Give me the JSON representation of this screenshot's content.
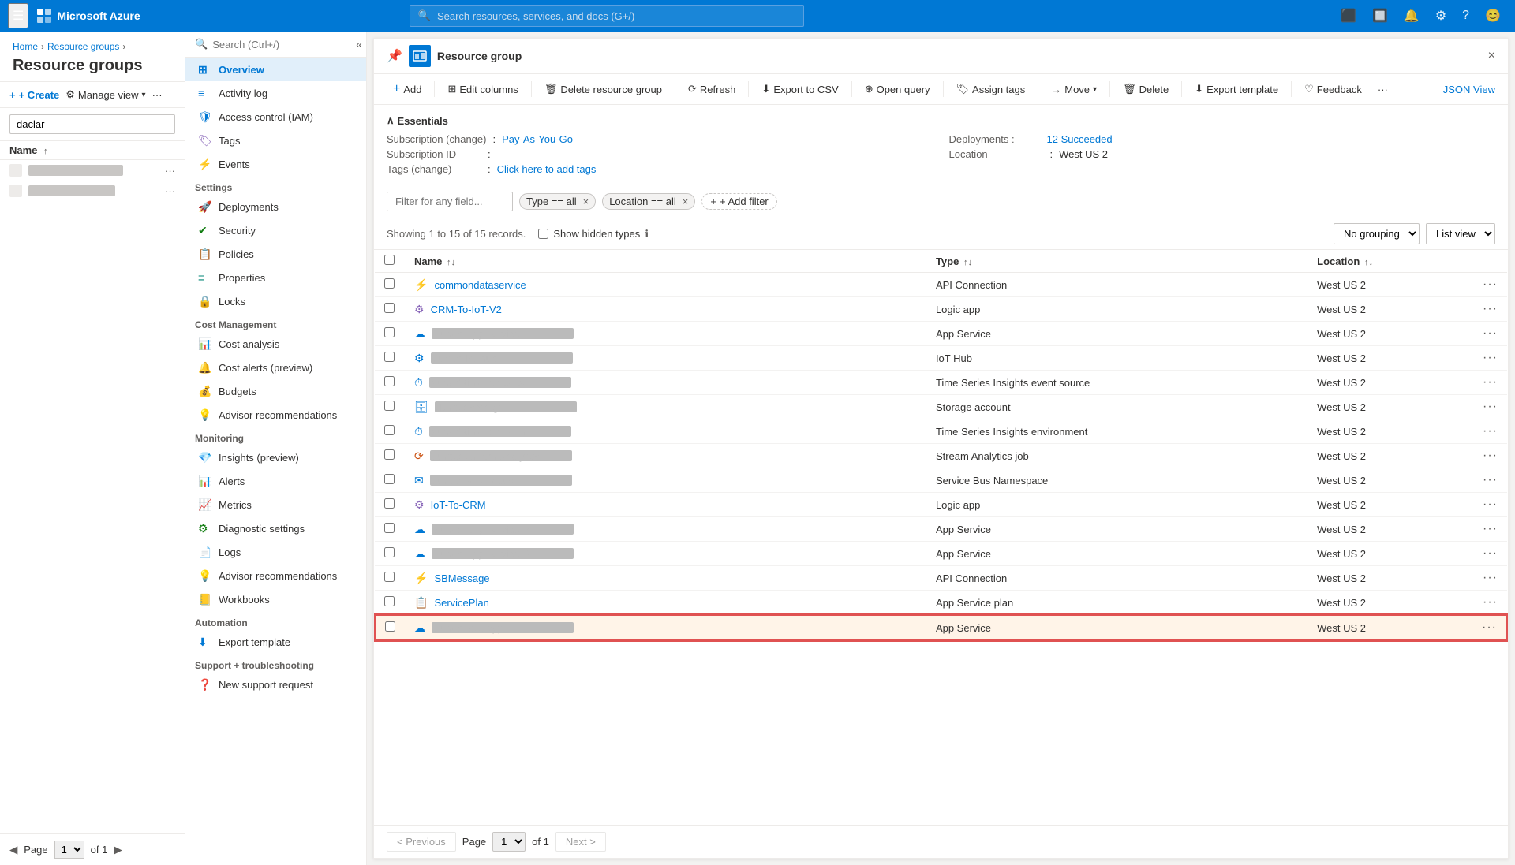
{
  "topNav": {
    "logo": "Microsoft Azure",
    "searchPlaceholder": "Search resources, services, and docs (G+/)",
    "hamburgerLabel": "Menu"
  },
  "breadcrumb": {
    "items": [
      "Home",
      "Resource groups"
    ]
  },
  "pageTitle": "Resource groups",
  "sidebarActions": {
    "create": "+ Create",
    "manageView": "Manage view",
    "more": "···"
  },
  "sidebarSearch": {
    "placeholder": "daclar",
    "searchPlaceholder": "Search (Ctrl+/)"
  },
  "sidebarColumns": {
    "nameHeader": "Name"
  },
  "sidebarItems": [
    {
      "name": "item1",
      "blurred": true
    },
    {
      "name": "item2",
      "blurred": true
    }
  ],
  "leftNavItems": [
    {
      "id": "overview",
      "label": "Overview",
      "icon": "grid"
    },
    {
      "id": "activity-log",
      "label": "Activity log",
      "icon": "list"
    },
    {
      "id": "access-control",
      "label": "Access control (IAM)",
      "icon": "shield"
    },
    {
      "id": "tags",
      "label": "Tags",
      "icon": "tag"
    },
    {
      "id": "events",
      "label": "Events",
      "icon": "lightning"
    }
  ],
  "settingsSection": "Settings",
  "settingsItems": [
    {
      "id": "deployments",
      "label": "Deployments",
      "icon": "rocket"
    },
    {
      "id": "security",
      "label": "Security",
      "icon": "shield-check"
    },
    {
      "id": "policies",
      "label": "Policies",
      "icon": "policy"
    },
    {
      "id": "properties",
      "label": "Properties",
      "icon": "properties"
    },
    {
      "id": "locks",
      "label": "Locks",
      "icon": "lock"
    }
  ],
  "costSection": "Cost Management",
  "costItems": [
    {
      "id": "cost-analysis",
      "label": "Cost analysis",
      "icon": "chart"
    },
    {
      "id": "cost-alerts",
      "label": "Cost alerts (preview)",
      "icon": "bell"
    },
    {
      "id": "budgets",
      "label": "Budgets",
      "icon": "budget"
    },
    {
      "id": "advisor-rec-cost",
      "label": "Advisor recommendations",
      "icon": "advisor"
    }
  ],
  "monitoringSection": "Monitoring",
  "monitoringItems": [
    {
      "id": "insights",
      "label": "Insights (preview)",
      "icon": "insights"
    },
    {
      "id": "alerts",
      "label": "Alerts",
      "icon": "alert"
    },
    {
      "id": "metrics",
      "label": "Metrics",
      "icon": "metrics"
    },
    {
      "id": "diagnostic",
      "label": "Diagnostic settings",
      "icon": "diagnostic"
    },
    {
      "id": "logs",
      "label": "Logs",
      "icon": "logs"
    },
    {
      "id": "advisor-rec",
      "label": "Advisor recommendations",
      "icon": "advisor2"
    },
    {
      "id": "workbooks",
      "label": "Workbooks",
      "icon": "workbooks"
    }
  ],
  "automationSection": "Automation",
  "automationItems": [
    {
      "id": "export-template",
      "label": "Export template",
      "icon": "export"
    }
  ],
  "supportSection": "Support + troubleshooting",
  "supportItems": [
    {
      "id": "new-support",
      "label": "New support request",
      "icon": "support"
    }
  ],
  "pagination": {
    "previous": "< Previous",
    "pageLabel": "Page",
    "pageValue": "1",
    "ofLabel": "of 1",
    "next": "Next >"
  },
  "panel": {
    "resourceGroupLabel": "Resource group",
    "closeLabel": "×"
  },
  "toolbar": {
    "add": "Add",
    "editColumns": "Edit columns",
    "deleteResourceGroup": "Delete resource group",
    "refresh": "Refresh",
    "exportToCSV": "Export to CSV",
    "openQuery": "Open query",
    "assignTags": "Assign tags",
    "move": "Move",
    "delete": "Delete",
    "exportTemplate": "Export template",
    "feedback": "Feedback",
    "moreActions": "···",
    "jsonView": "JSON View"
  },
  "essentials": {
    "title": "Essentials",
    "subscriptionLabel": "Subscription (change)",
    "subscriptionValue": "Pay-As-You-Go",
    "subscriptionIdLabel": "Subscription ID",
    "subscriptionIdValue": ":",
    "tagsLabel": "Tags (change)",
    "tagsValue": "Click here to add tags",
    "deploymentsLabel": "Deployments :",
    "deploymentsValue": "12 Succeeded",
    "locationLabel": "Location",
    "locationValue": "West US 2"
  },
  "filterBar": {
    "placeholder": "Filter for any field...",
    "tag1": "Type == all",
    "tag2": "Location == all",
    "addFilter": "+ Add filter"
  },
  "recordsBar": {
    "text": "Showing 1 to 15 of 15 records.",
    "showHiddenTypes": "Show hidden types",
    "groupingLabel": "No grouping",
    "viewLabel": "List view"
  },
  "tableHeaders": {
    "name": "Name",
    "type": "Type",
    "location": "Location"
  },
  "tableRows": [
    {
      "id": 1,
      "name": "commondataservice",
      "nameBlurred": false,
      "type": "API Connection",
      "location": "West US 2",
      "iconColor": "#0078d4",
      "iconChar": "⚡"
    },
    {
      "id": 2,
      "name": "CRM-To-IoT-V2",
      "nameBlurred": false,
      "type": "Logic app",
      "location": "West US 2",
      "iconColor": "#8764b8",
      "iconChar": "⚙"
    },
    {
      "id": 3,
      "name": "blurred-app-service-1",
      "nameBlurred": true,
      "type": "App Service",
      "location": "West US 2",
      "iconColor": "#0078d4",
      "iconChar": "☁"
    },
    {
      "id": 4,
      "name": "blurred-iot-hub",
      "nameBlurred": true,
      "type": "IoT Hub",
      "location": "West US 2",
      "iconColor": "#0078d4",
      "iconChar": "⚙"
    },
    {
      "id": 5,
      "name": "blurred-timeseries-event",
      "nameBlurred": true,
      "type": "Time Series Insights event source",
      "location": "West US 2",
      "iconColor": "#0078d4",
      "iconChar": "⏱"
    },
    {
      "id": 6,
      "name": "blurred-storage",
      "nameBlurred": true,
      "type": "Storage account",
      "location": "West US 2",
      "iconColor": "#0078d4",
      "iconChar": "🗄"
    },
    {
      "id": 7,
      "name": "blurred-timeseries-env",
      "nameBlurred": true,
      "type": "Time Series Insights environment",
      "location": "West US 2",
      "iconColor": "#0078d4",
      "iconChar": "⏱"
    },
    {
      "id": 8,
      "name": "blurred-stream-analytics",
      "nameBlurred": true,
      "type": "Stream Analytics job",
      "location": "West US 2",
      "iconColor": "#ca5010",
      "iconChar": "⟳"
    },
    {
      "id": 9,
      "name": "blurred-servicebus",
      "nameBlurred": true,
      "type": "Service Bus Namespace",
      "location": "West US 2",
      "iconColor": "#0078d4",
      "iconChar": "✉"
    },
    {
      "id": 10,
      "name": "IoT-To-CRM",
      "nameBlurred": false,
      "type": "Logic app",
      "location": "West US 2",
      "iconColor": "#8764b8",
      "iconChar": "⚙"
    },
    {
      "id": 11,
      "name": "blurred-app-service-2",
      "nameBlurred": true,
      "type": "App Service",
      "location": "West US 2",
      "iconColor": "#0078d4",
      "iconChar": "☁"
    },
    {
      "id": 12,
      "name": "blurred-app-service-3",
      "nameBlurred": true,
      "type": "App Service",
      "location": "West US 2",
      "iconColor": "#0078d4",
      "iconChar": "☁"
    },
    {
      "id": 13,
      "name": "SBMessage",
      "nameBlurred": false,
      "type": "API Connection",
      "location": "West US 2",
      "iconColor": "#0078d4",
      "iconChar": "⚡"
    },
    {
      "id": 14,
      "name": "ServicePlan",
      "nameBlurred": false,
      "type": "App Service plan",
      "location": "West US 2",
      "iconColor": "#0078d4",
      "iconChar": "📋"
    },
    {
      "id": 15,
      "name": "blurred-last-app",
      "nameBlurred": true,
      "type": "App Service",
      "location": "West US 2",
      "iconColor": "#0078d4",
      "iconChar": "☁",
      "selected": true
    }
  ]
}
